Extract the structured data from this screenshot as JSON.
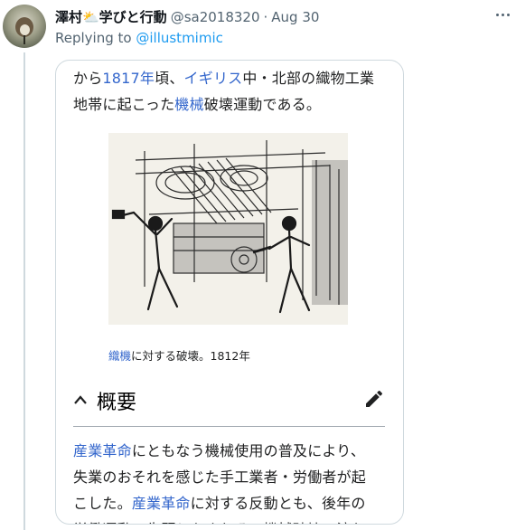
{
  "tweet": {
    "display_name": "澤村⛅学びと行動",
    "handle": "@sa2018320",
    "separator": "·",
    "date": "Aug 30",
    "replying_prefix": "Replying to",
    "replying_mention": "@illustmimic"
  },
  "article": {
    "intro_line1": [
      "から",
      "1817年",
      "頃、",
      "イギリス",
      "中・北部の織物工業"
    ],
    "intro_line2": [
      "地帯に起こった",
      "機械",
      "破壊運動である。"
    ],
    "caption_link": "織機",
    "caption_rest": "に対する破壊。1812年",
    "section_title": "概要",
    "body_line1": [
      "産業革命",
      "にともなう機械使用の普及により、"
    ],
    "body_line2": "失業のおそれを感じた手工業者・労働者が起",
    "body_line3": [
      "こした。",
      "産業革命",
      "に対する反動とも、後年の"
    ],
    "body_line4": "労働運動の先駆ともされる。機械破壊の流れ"
  },
  "colors": {
    "link_blue": "#3366cc",
    "twitter_blue": "#1d9bf0",
    "muted_gray": "#536471"
  }
}
